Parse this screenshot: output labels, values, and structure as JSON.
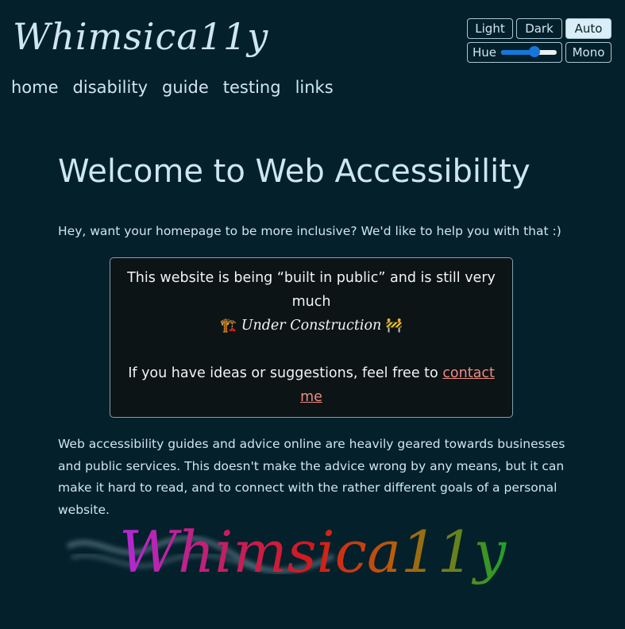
{
  "site": {
    "logo": "Whimsica11y"
  },
  "controls": {
    "light": "Light",
    "dark": "Dark",
    "auto": "Auto",
    "hue": "Hue",
    "hue_level": 0.6,
    "mono": "Mono",
    "active_mode": "Auto"
  },
  "nav": [
    "home",
    "disability",
    "guide",
    "testing",
    "links"
  ],
  "main": {
    "title": "Welcome to Web Accessibility",
    "intro": "Hey, want your homepage to be more inclusive? We'd like to help you with that :)",
    "notice": {
      "line1": "This website is being “built in public” and is still very much",
      "construction_label": "Under Construction",
      "crane_icon": "🏗️",
      "barrier_icon": "🚧",
      "ideas_prefix": "If you have ideas or suggestions, feel free to",
      "contact_link": "contact me"
    },
    "paragraph": "Web accessibility guides and advice online are heavily geared towards businesses and public services. This doesn't make the advice wrong by any means, but it can make it hard to read, and to connect with the rather different goals of a personal website."
  },
  "banner": {
    "text": "Whimsica11y"
  },
  "colors": {
    "background": "#04202b",
    "text": "#cfe6ef",
    "link": "#f08a84",
    "slider_accent": "#1677d9"
  }
}
